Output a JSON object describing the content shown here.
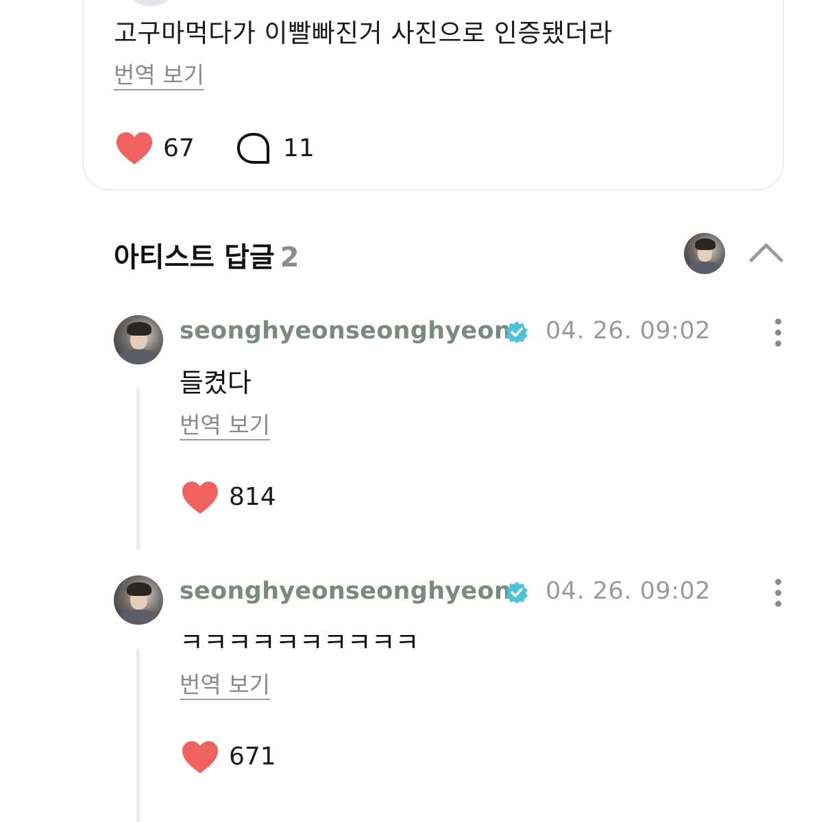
{
  "post": {
    "text": "고구마먹다가 이빨빠진거 사진으로 인증됐더라",
    "translate_label": "번역 보기",
    "like_count": "67",
    "comment_count": "11"
  },
  "artist_replies": {
    "title": "아티스트 답글",
    "count": "2",
    "replies": [
      {
        "username": "seonghyeonseonghyeon",
        "timestamp": "04. 26. 09:02",
        "text": "들켰다",
        "translate_label": "번역 보기",
        "like_count": "814"
      },
      {
        "username": "seonghyeonseonghyeon",
        "timestamp": "04. 26. 09:02",
        "text": "ㅋㅋㅋㅋㅋㅋㅋㅋㅋㅋ",
        "translate_label": "번역 보기",
        "like_count": "671"
      }
    ]
  },
  "colors": {
    "heart": "#f0625f",
    "username": "#7a8a7c",
    "verified": "#4cc3dd",
    "muted": "#9a9a9a"
  },
  "icons": {
    "like": "heart-icon",
    "comment": "speech-bubble-icon",
    "verified": "verified-badge-icon",
    "collapse": "chevron-up-icon",
    "more": "more-vertical-icon"
  }
}
